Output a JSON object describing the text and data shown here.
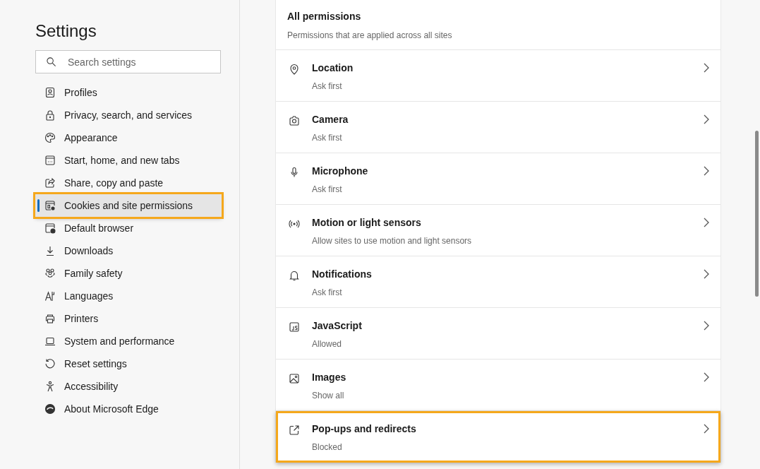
{
  "sidebar": {
    "title": "Settings",
    "search": {
      "placeholder": "Search settings"
    },
    "items": [
      {
        "label": "Profiles",
        "selected": false,
        "highlighted": false
      },
      {
        "label": "Privacy, search, and services",
        "selected": false,
        "highlighted": false
      },
      {
        "label": "Appearance",
        "selected": false,
        "highlighted": false
      },
      {
        "label": "Start, home, and new tabs",
        "selected": false,
        "highlighted": false
      },
      {
        "label": "Share, copy and paste",
        "selected": false,
        "highlighted": false
      },
      {
        "label": "Cookies and site permissions",
        "selected": true,
        "highlighted": true
      },
      {
        "label": "Default browser",
        "selected": false,
        "highlighted": false
      },
      {
        "label": "Downloads",
        "selected": false,
        "highlighted": false
      },
      {
        "label": "Family safety",
        "selected": false,
        "highlighted": false
      },
      {
        "label": "Languages",
        "selected": false,
        "highlighted": false
      },
      {
        "label": "Printers",
        "selected": false,
        "highlighted": false
      },
      {
        "label": "System and performance",
        "selected": false,
        "highlighted": false
      },
      {
        "label": "Reset settings",
        "selected": false,
        "highlighted": false
      },
      {
        "label": "Accessibility",
        "selected": false,
        "highlighted": false
      },
      {
        "label": "About Microsoft Edge",
        "selected": false,
        "highlighted": false
      }
    ]
  },
  "permissions": {
    "title": "All permissions",
    "subtitle": "Permissions that are applied across all sites",
    "items": [
      {
        "label": "Location",
        "status": "Ask first",
        "highlighted": false
      },
      {
        "label": "Camera",
        "status": "Ask first",
        "highlighted": false
      },
      {
        "label": "Microphone",
        "status": "Ask first",
        "highlighted": false
      },
      {
        "label": "Motion or light sensors",
        "status": "Allow sites to use motion and light sensors",
        "highlighted": false
      },
      {
        "label": "Notifications",
        "status": "Ask first",
        "highlighted": false
      },
      {
        "label": "JavaScript",
        "status": "Allowed",
        "highlighted": false
      },
      {
        "label": "Images",
        "status": "Show all",
        "highlighted": false
      },
      {
        "label": "Pop-ups and redirects",
        "status": "Blocked",
        "highlighted": true
      }
    ]
  }
}
